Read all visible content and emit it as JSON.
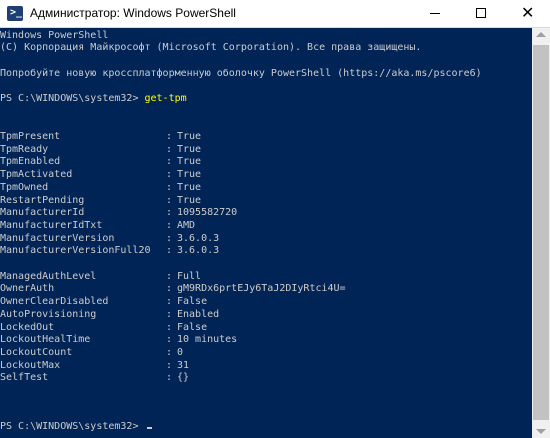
{
  "window": {
    "title": "Администратор: Windows PowerShell",
    "icon_text": ">_",
    "controls": {
      "minimize": "—",
      "maximize": "",
      "close": "✕"
    }
  },
  "console": {
    "banner_line1": "Windows PowerShell",
    "banner_line2": "(С) Корпорация Майкрософт (Microsoft Corporation). Все права защищены.",
    "banner_line3": "Попробуйте новую кроссплатформенную оболочку PowerShell (https://aka.ms/pscore6)",
    "prompt1": "PS C:\\WINDOWS\\system32> ",
    "command1": "get-tpm",
    "output": [
      {
        "key": "TpmPresent",
        "value": "True"
      },
      {
        "key": "TpmReady",
        "value": "True"
      },
      {
        "key": "TpmEnabled",
        "value": "True"
      },
      {
        "key": "TpmActivated",
        "value": "True"
      },
      {
        "key": "TpmOwned",
        "value": "True"
      },
      {
        "key": "RestartPending",
        "value": "True"
      },
      {
        "key": "ManufacturerId",
        "value": "1095582720"
      },
      {
        "key": "ManufacturerIdTxt",
        "value": "AMD"
      },
      {
        "key": "ManufacturerVersion",
        "value": "3.6.0.3"
      },
      {
        "key": "ManufacturerVersionFull20",
        "value": "3.6.0.3"
      },
      {
        "key": "ManagedAuthLevel",
        "value": "Full"
      },
      {
        "key": "OwnerAuth",
        "value": "gM9RDx6prtEJy6TaJ2DIyRtci4U="
      },
      {
        "key": "OwnerClearDisabled",
        "value": "False"
      },
      {
        "key": "AutoProvisioning",
        "value": "Enabled"
      },
      {
        "key": "LockedOut",
        "value": "False"
      },
      {
        "key": "LockoutHealTime",
        "value": "10 minutes"
      },
      {
        "key": "LockoutCount",
        "value": "0"
      },
      {
        "key": "LockoutMax",
        "value": "31"
      },
      {
        "key": "SelfTest",
        "value": "{}"
      }
    ],
    "prompt2": "PS C:\\WINDOWS\\system32> "
  },
  "colors": {
    "background": "#012456",
    "text": "#cccccc",
    "command": "#ffff00"
  }
}
